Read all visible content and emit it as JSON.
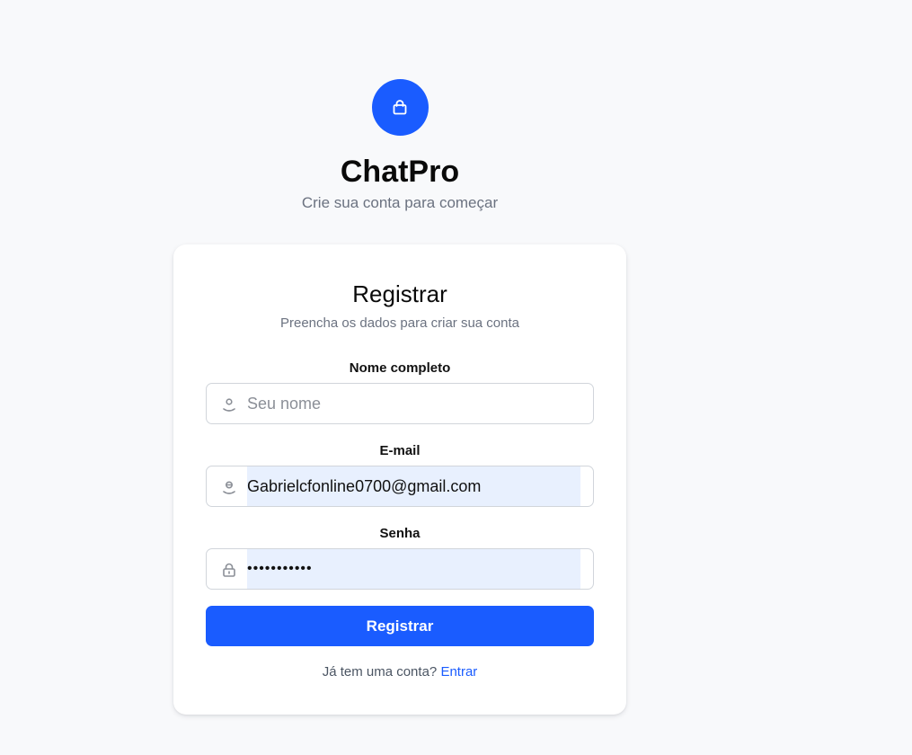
{
  "brand": {
    "title": "ChatPro",
    "subtitle": "Crie sua conta para começar",
    "logo_icon": "shopping-bag-icon",
    "accent_color": "#1a5cff"
  },
  "form": {
    "title": "Registrar",
    "subtitle": "Preencha os dados para criar sua conta",
    "name": {
      "label": "Nome completo",
      "placeholder": "Seu nome",
      "value": "",
      "icon": "user-icon"
    },
    "email": {
      "label": "E-mail",
      "placeholder": "",
      "value": "Gabrielcfonline0700@gmail.com",
      "icon": "mail-user-icon"
    },
    "password": {
      "label": "Senha",
      "value": "•••••••••••",
      "icon": "lock-icon"
    },
    "submit_label": "Registrar",
    "footer_text": "Já tem uma conta?",
    "login_link": "Entrar"
  }
}
